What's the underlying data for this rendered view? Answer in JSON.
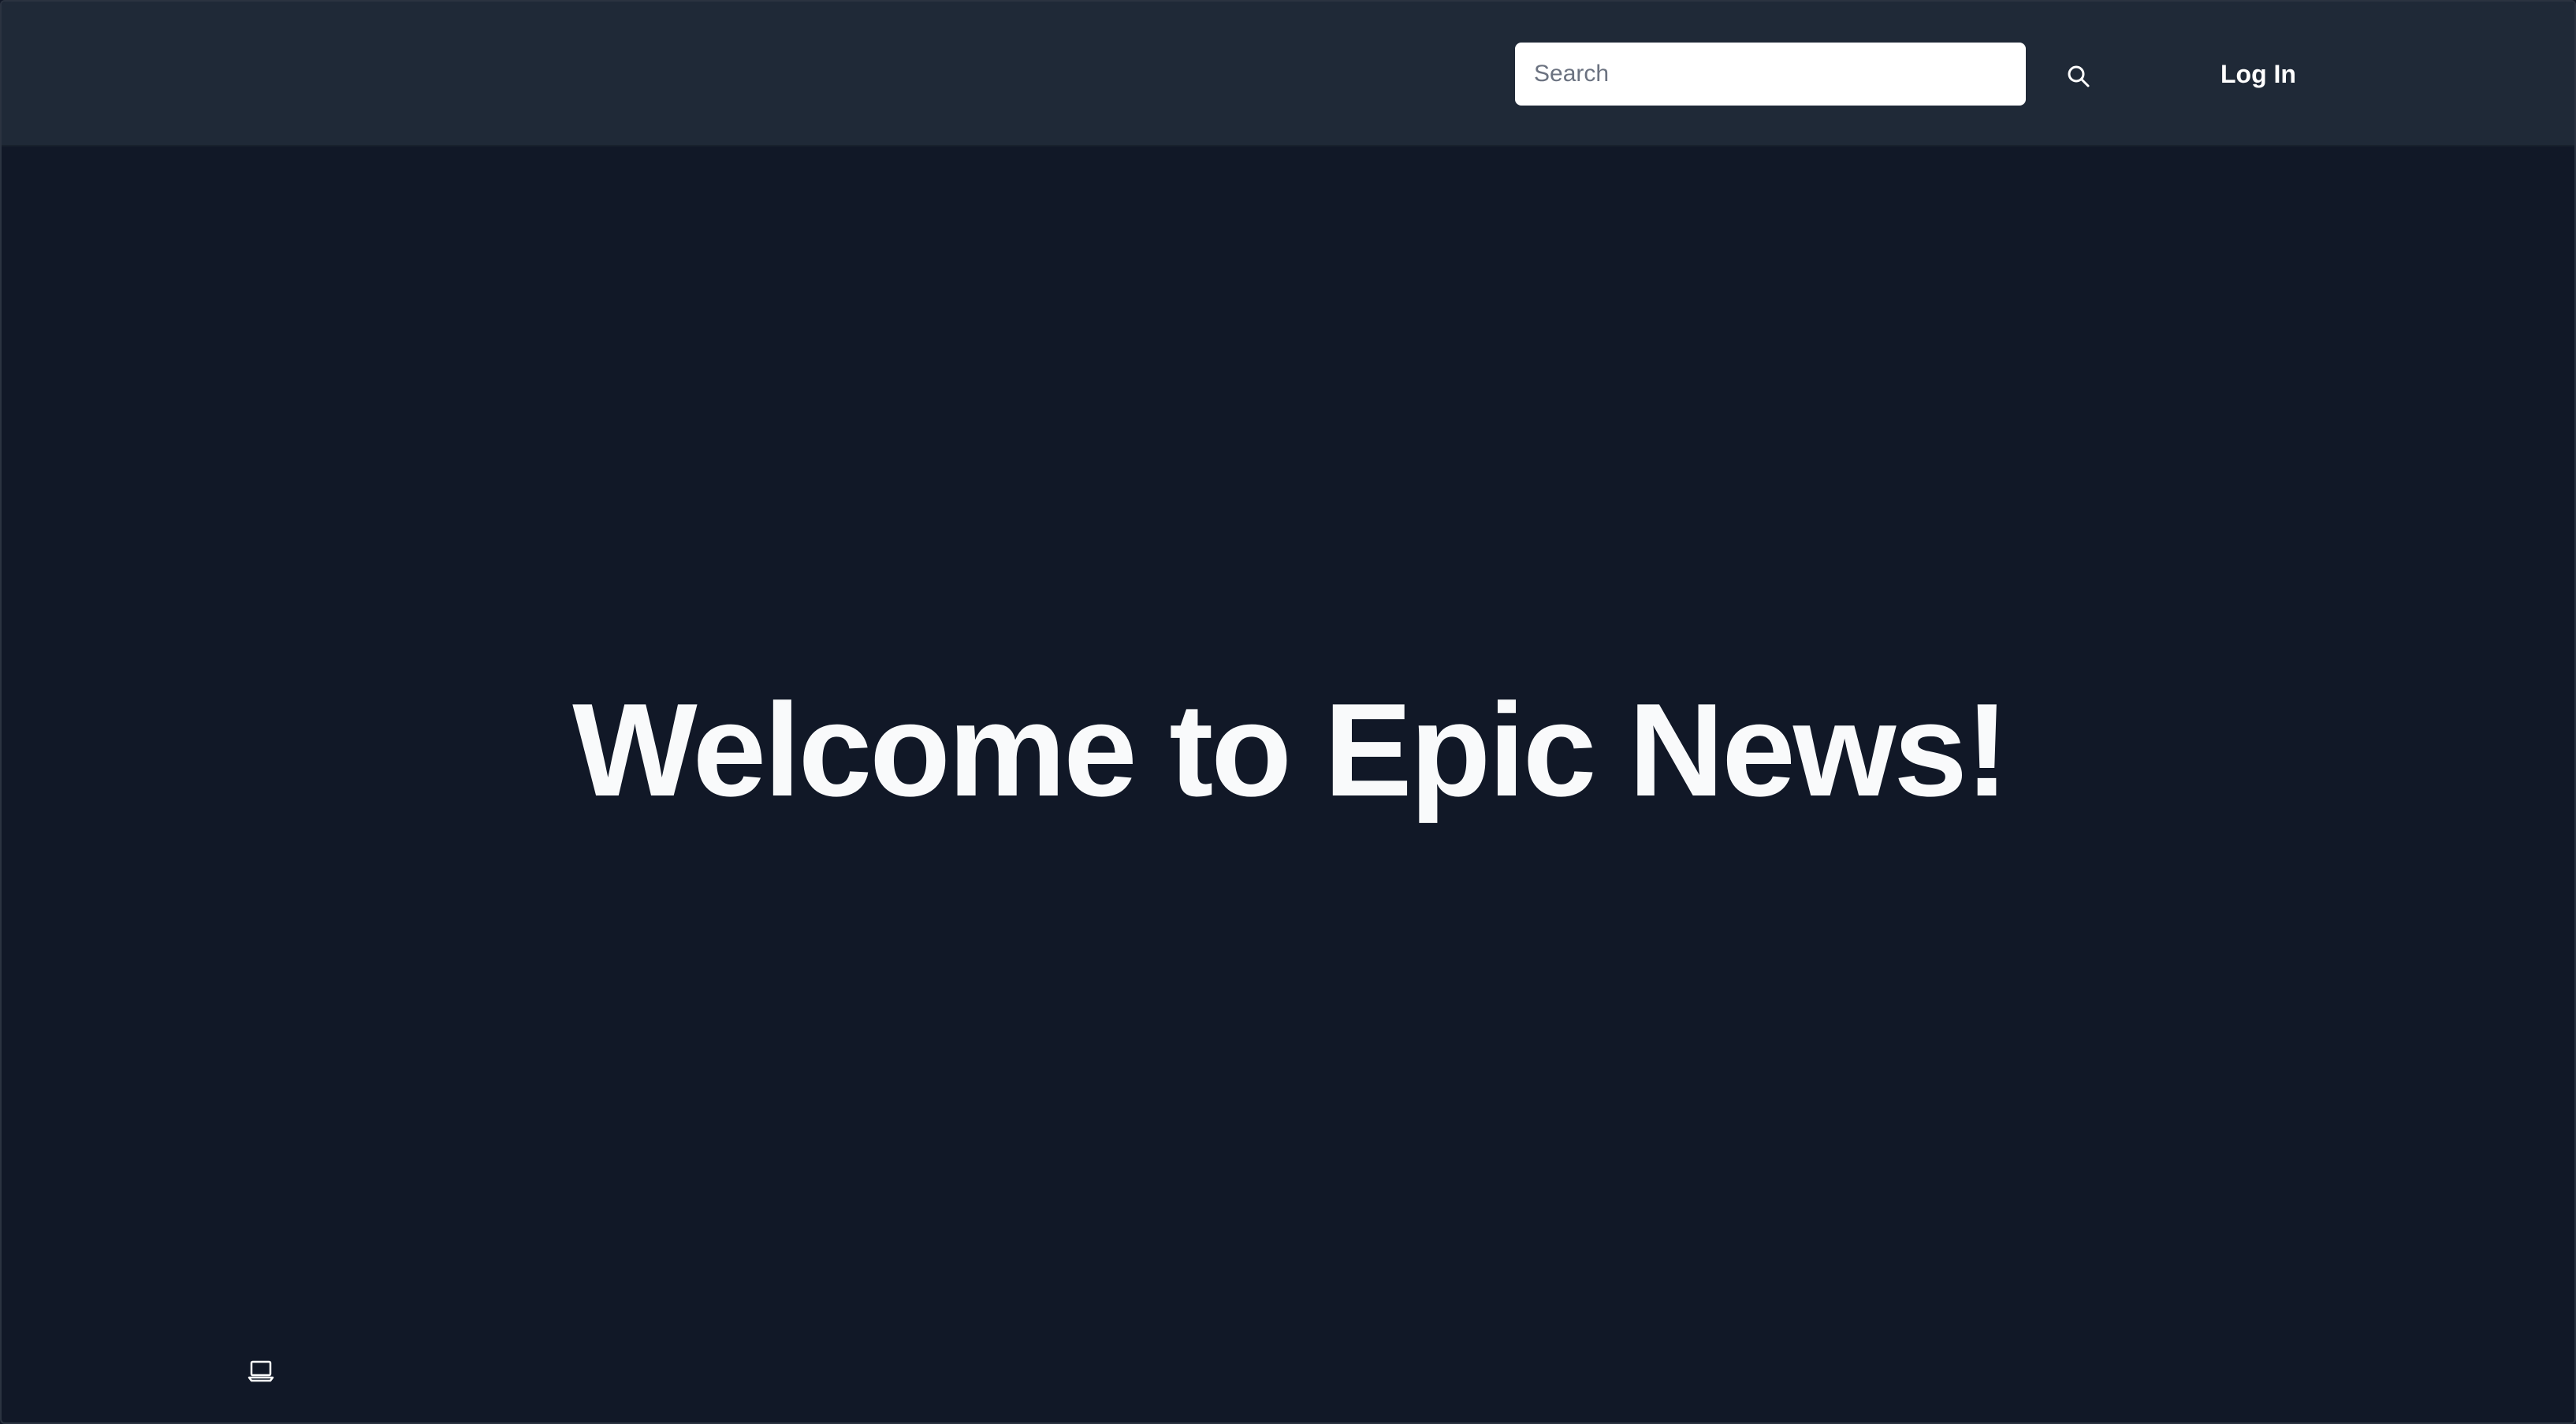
{
  "header": {
    "search": {
      "placeholder": "Search"
    },
    "search_button": {
      "icon": "search-icon"
    },
    "login": {
      "label": "Log In"
    }
  },
  "hero": {
    "title": "Welcome to Epic News!"
  },
  "footer": {
    "theme_button": {
      "icon": "laptop-icon"
    }
  },
  "colors": {
    "background": "#111827",
    "header": "#1f2937",
    "text": "#ffffff",
    "input_background": "#ffffff",
    "input_placeholder": "#6b7280"
  }
}
